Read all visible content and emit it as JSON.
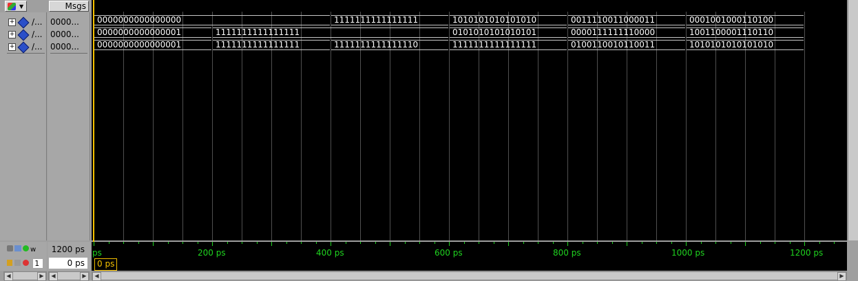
{
  "header": {
    "msgs_label": "Msgs"
  },
  "signals": [
    {
      "name": "/...",
      "value": "0000..."
    },
    {
      "name": "/...",
      "value": "0000..."
    },
    {
      "name": "/...",
      "value": "0000..."
    }
  ],
  "wave_rows": [
    [
      "0000000000000000",
      "1111111111111111",
      "1010101010101010",
      "0011110011000011",
      "0001001000110100"
    ],
    [
      "0000000000000001",
      "1111111111111111",
      "0101010101010101",
      "0000111111110000",
      "1001100001110110"
    ],
    [
      "0000000000000001",
      "1111111111111111",
      "1111111111111110",
      "1111111111111111",
      "0100110010110011",
      "1010101010101010"
    ]
  ],
  "toolbar_bottom": {
    "now_label": "w",
    "now_value": "1200 ps",
    "cursor_num": "1",
    "cursor_value": "0 ps"
  },
  "timeline": {
    "start_label": "ps",
    "ticks": [
      "200 ps",
      "400 ps",
      "600 ps",
      "800 ps",
      "1000 ps",
      "1200 ps"
    ],
    "cursor_label": "0 ps"
  },
  "colors": {
    "wave_bg": "#000000",
    "bus": "#c8c8c8",
    "grid": "#505050",
    "cursor": "#f6c200",
    "timeline_text": "#1fd41f"
  }
}
